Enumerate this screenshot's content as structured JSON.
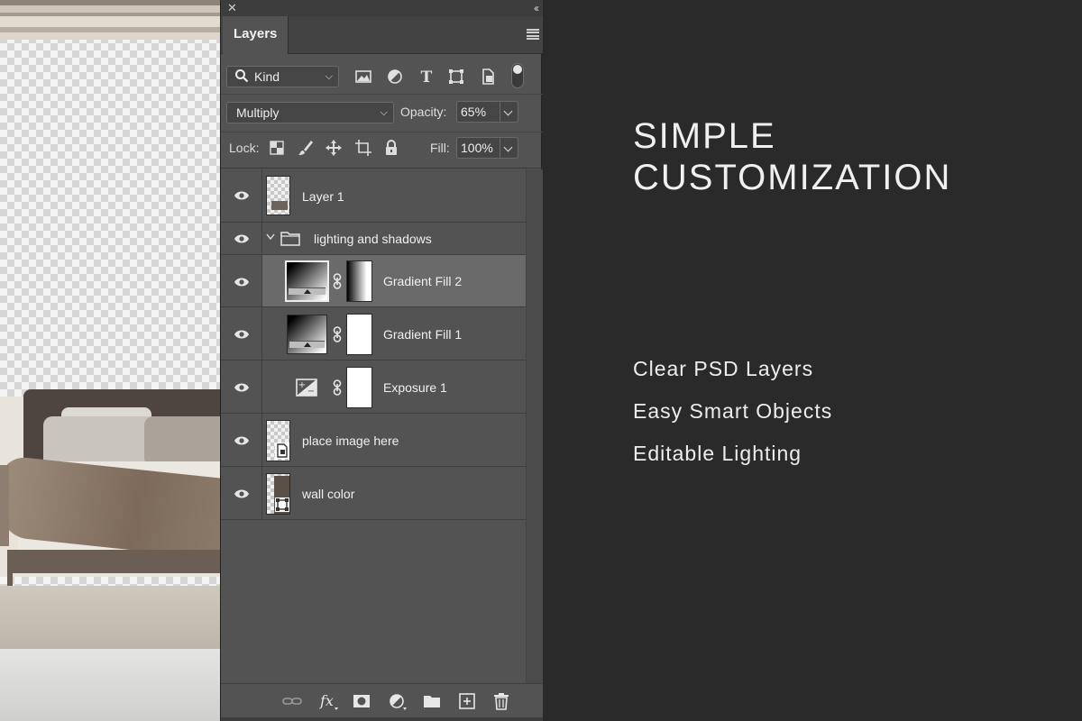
{
  "panel": {
    "tab_label": "Layers",
    "filter_kind": "Kind",
    "blend_mode": "Multiply",
    "opacity_label": "Opacity:",
    "opacity_value": "65%",
    "lock_label": "Lock:",
    "fill_label": "Fill:",
    "fill_value": "100%"
  },
  "layers": [
    {
      "name": "Layer 1",
      "visible": true,
      "kind": "pixel"
    },
    {
      "name": "lighting and shadows",
      "visible": true,
      "kind": "group",
      "expanded": true
    },
    {
      "name": "Gradient Fill 2",
      "visible": true,
      "kind": "gradient-fill",
      "selected": true
    },
    {
      "name": "Gradient Fill 1",
      "visible": true,
      "kind": "gradient-fill"
    },
    {
      "name": "Exposure 1",
      "visible": true,
      "kind": "adjustment"
    },
    {
      "name": "place image here",
      "visible": true,
      "kind": "smart-object"
    },
    {
      "name": "wall color",
      "visible": true,
      "kind": "shape"
    }
  ],
  "marketing": {
    "headline_line1": "SIMPLE",
    "headline_line2": "CUSTOMIZATION",
    "features": [
      "Clear PSD Layers",
      "Easy Smart Objects",
      "Editable Lighting"
    ]
  },
  "colors": {
    "background": "#2a2a2a",
    "panel": "#535353",
    "selected_row": "#6a6a6a"
  }
}
